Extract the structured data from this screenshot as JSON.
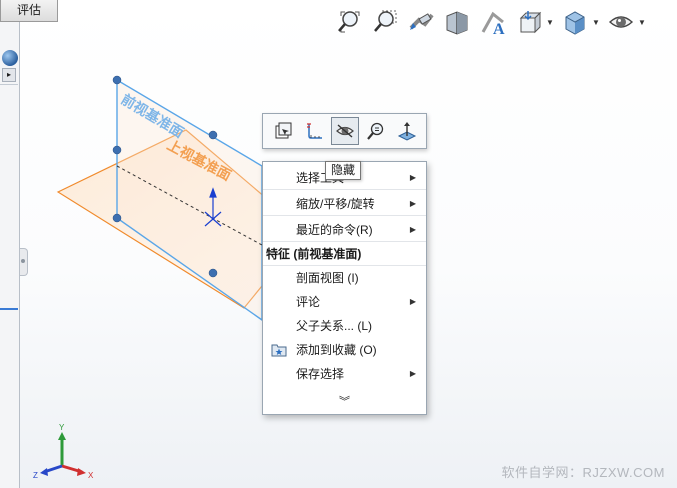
{
  "tabs": {
    "evaluate": "评估"
  },
  "toolbar": {
    "buttons": [
      {
        "name": "zoom-to-fit",
        "icon": "zoom-fit-icon"
      },
      {
        "name": "zoom-to-area",
        "icon": "zoom-area-icon"
      },
      {
        "name": "previous-view",
        "icon": "previous-view-icon"
      },
      {
        "name": "section-view",
        "icon": "section-view-icon"
      },
      {
        "name": "dynamic-annotation",
        "icon": "annotation-icon"
      },
      {
        "name": "view-orientation",
        "icon": "view-orientation-icon",
        "dropdown": true
      },
      {
        "name": "display-style",
        "icon": "display-style-icon",
        "dropdown": true
      },
      {
        "name": "hide-show-items",
        "icon": "eye-icon",
        "dropdown": true
      }
    ]
  },
  "planes": {
    "front": "前视基准面",
    "top": "上视基准面"
  },
  "hud": {
    "buttons": [
      {
        "name": "edit-feature",
        "icon": "edit-feature-icon"
      },
      {
        "name": "sketch",
        "icon": "sketch-icon"
      },
      {
        "name": "hide",
        "icon": "hide-icon",
        "active": true
      },
      {
        "name": "zoom-selection",
        "icon": "zoom-selection-icon"
      },
      {
        "name": "normal-to",
        "icon": "normal-to-icon"
      }
    ]
  },
  "tooltip": "隐藏",
  "menu": {
    "items": [
      {
        "label": "选择工具",
        "submenu": true
      },
      {
        "label": "缩放/平移/旋转",
        "submenu": true
      },
      {
        "label": "最近的命令(R)",
        "submenu": true
      },
      {
        "label": "特征 (前视基准面)",
        "header": true
      },
      {
        "label": "剖面视图 (I)"
      },
      {
        "label": "评论",
        "submenu": true
      },
      {
        "label": "父子关系... (L)"
      },
      {
        "label": "添加到收藏 (O)",
        "icon": "favorite-folder-icon"
      },
      {
        "label": "保存选择",
        "submenu": true
      }
    ],
    "more": "︾"
  },
  "triad": {
    "x": "X",
    "y": "Y",
    "z": "Z"
  },
  "watermark": "软件自学网：RJZXW.COM",
  "colors": {
    "front_plane": "#5aa6e8",
    "top_plane": "#f08a2c",
    "accent": "#3a7bd5"
  }
}
